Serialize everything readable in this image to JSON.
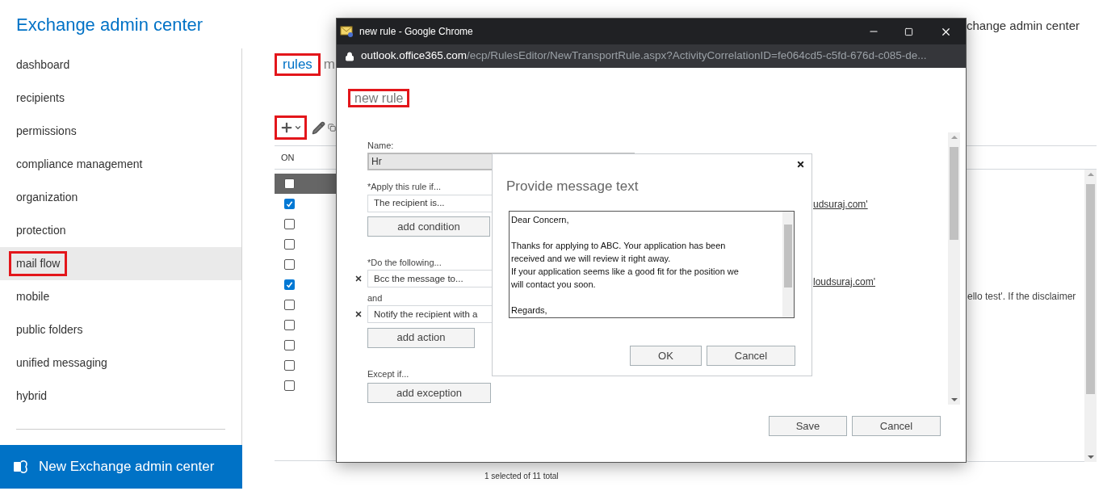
{
  "app": {
    "title": "Exchange admin center",
    "header_right": "change admin center"
  },
  "sidebar": {
    "items": [
      {
        "label": "dashboard",
        "selected": false,
        "highlighted": false
      },
      {
        "label": "recipients",
        "selected": false,
        "highlighted": false
      },
      {
        "label": "permissions",
        "selected": false,
        "highlighted": false
      },
      {
        "label": "compliance management",
        "selected": false,
        "highlighted": false
      },
      {
        "label": "organization",
        "selected": false,
        "highlighted": false
      },
      {
        "label": "protection",
        "selected": false,
        "highlighted": false
      },
      {
        "label": "mail flow",
        "selected": true,
        "highlighted": true
      },
      {
        "label": "mobile",
        "selected": false,
        "highlighted": false
      },
      {
        "label": "public folders",
        "selected": false,
        "highlighted": false
      },
      {
        "label": "unified messaging",
        "selected": false,
        "highlighted": false
      },
      {
        "label": "hybrid",
        "selected": false,
        "highlighted": false
      }
    ],
    "footer": "New Exchange admin center"
  },
  "tabs": [
    {
      "label": "rules",
      "selected": true,
      "highlighted": true
    },
    {
      "label": "m",
      "selected": false,
      "highlighted": false
    }
  ],
  "toolbar": {
    "add_highlighted": true
  },
  "table": {
    "columns": [
      "ON"
    ],
    "rows": [
      {
        "checked": false,
        "selected": true
      },
      {
        "checked": true,
        "selected": false
      },
      {
        "checked": false,
        "selected": false
      },
      {
        "checked": false,
        "selected": false
      },
      {
        "checked": false,
        "selected": false
      },
      {
        "checked": true,
        "selected": false
      },
      {
        "checked": false,
        "selected": false
      },
      {
        "checked": false,
        "selected": false
      },
      {
        "checked": false,
        "selected": false
      },
      {
        "checked": false,
        "selected": false
      },
      {
        "checked": false,
        "selected": false
      }
    ]
  },
  "details": {
    "text": "ello test'. If the disclaimer"
  },
  "status_bar": "1 selected of 11 total",
  "browser": {
    "title": "new rule - Google Chrome",
    "url_host": "outlook.office365.com",
    "url_path": "/ecp/RulesEditor/NewTransportRule.aspx?ActivityCorrelationID=fe064cd5-c5fd-676d-c085-de...",
    "heading": "new rule",
    "heading_highlighted": true,
    "form": {
      "name_label": "Name:",
      "name_value": "Hr",
      "conditions_label": "*Apply this rule if...",
      "conditions": [
        "The recipient is..."
      ],
      "add_condition": "add condition",
      "actions_label": "*Do the following...",
      "actions": [
        "Bcc the message to...",
        "Notify the recipient with a"
      ],
      "joiner": "and",
      "add_action": "add action",
      "exceptions_label": "Except if...",
      "add_exception": "add exception"
    },
    "summary_links": [
      "udsuraj.com'",
      "loudsuraj.com'"
    ],
    "buttons": [
      "Save",
      "Cancel"
    ]
  },
  "dialog": {
    "title": "Provide message text",
    "message": [
      [
        "Dear Concern,"
      ],
      [
        "Thanks for applying to ABC. Your application has been",
        "received and we will review it right away.",
        "If your application seems like a good fit for the position we",
        "will contact you soon."
      ],
      [
        "Regards,"
      ]
    ],
    "buttons": [
      "OK",
      "Cancel"
    ]
  }
}
